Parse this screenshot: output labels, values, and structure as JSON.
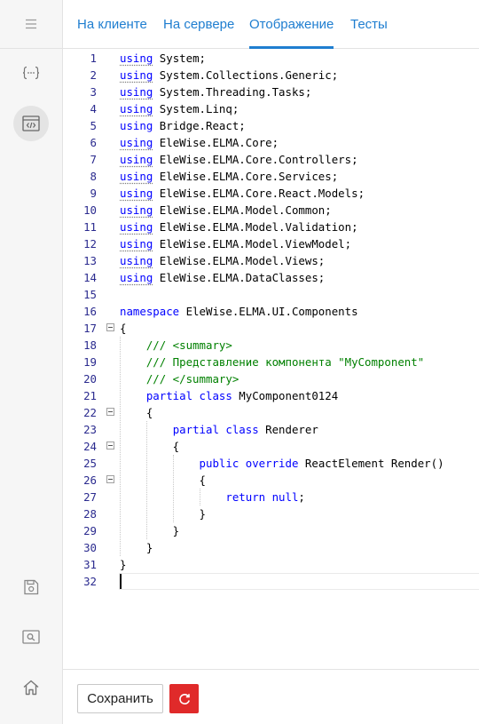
{
  "sidebar": {
    "menu_icon": "hamburger-menu-icon",
    "items": [
      {
        "icon": "code-braces-icon"
      },
      {
        "icon": "code-window-icon",
        "active": true
      },
      {
        "icon": "save-icon"
      },
      {
        "icon": "search-window-icon"
      },
      {
        "icon": "home-icon"
      }
    ]
  },
  "tabs": [
    {
      "label": "На клиенте"
    },
    {
      "label": "На сервере"
    },
    {
      "label": "Отображение",
      "active": true
    },
    {
      "label": "Тесты"
    }
  ],
  "editor": {
    "lines": [
      {
        "n": "1",
        "parts": [
          [
            "uw",
            "using"
          ],
          [
            "t",
            " System;"
          ]
        ]
      },
      {
        "n": "2",
        "parts": [
          [
            "uw",
            "using"
          ],
          [
            "t",
            " System.Collections.Generic;"
          ]
        ]
      },
      {
        "n": "3",
        "parts": [
          [
            "uw",
            "using"
          ],
          [
            "t",
            " System.Threading.Tasks;"
          ]
        ]
      },
      {
        "n": "4",
        "parts": [
          [
            "uw",
            "using"
          ],
          [
            "t",
            " System.Linq;"
          ]
        ]
      },
      {
        "n": "5",
        "parts": [
          [
            "kw",
            "using"
          ],
          [
            "t",
            " Bridge.React;"
          ]
        ]
      },
      {
        "n": "6",
        "parts": [
          [
            "uw",
            "using"
          ],
          [
            "t",
            " EleWise.ELMA.Core;"
          ]
        ]
      },
      {
        "n": "7",
        "parts": [
          [
            "uw",
            "using"
          ],
          [
            "t",
            " EleWise.ELMA.Core.Controllers;"
          ]
        ]
      },
      {
        "n": "8",
        "parts": [
          [
            "uw",
            "using"
          ],
          [
            "t",
            " EleWise.ELMA.Core.Services;"
          ]
        ]
      },
      {
        "n": "9",
        "parts": [
          [
            "uw",
            "using"
          ],
          [
            "t",
            " EleWise.ELMA.Core.React.Models;"
          ]
        ]
      },
      {
        "n": "10",
        "parts": [
          [
            "uw",
            "using"
          ],
          [
            "t",
            " EleWise.ELMA.Model.Common;"
          ]
        ]
      },
      {
        "n": "11",
        "parts": [
          [
            "uw",
            "using"
          ],
          [
            "t",
            " EleWise.ELMA.Model.Validation;"
          ]
        ]
      },
      {
        "n": "12",
        "parts": [
          [
            "uw",
            "using"
          ],
          [
            "t",
            " EleWise.ELMA.Model.ViewModel;"
          ]
        ]
      },
      {
        "n": "13",
        "parts": [
          [
            "uw",
            "using"
          ],
          [
            "t",
            " EleWise.ELMA.Model.Views;"
          ]
        ]
      },
      {
        "n": "14",
        "parts": [
          [
            "uw",
            "using"
          ],
          [
            "t",
            " EleWise.ELMA.DataClasses;"
          ]
        ]
      },
      {
        "n": "15",
        "parts": []
      },
      {
        "n": "16",
        "parts": [
          [
            "kw",
            "namespace"
          ],
          [
            "t",
            " EleWise.ELMA.UI.Components"
          ]
        ]
      },
      {
        "n": "17",
        "fold": true,
        "parts": [
          [
            "t",
            "{"
          ]
        ]
      },
      {
        "n": "18",
        "parts": [
          [
            "t",
            "    "
          ],
          [
            "cm",
            "/// <summary>"
          ]
        ]
      },
      {
        "n": "19",
        "parts": [
          [
            "t",
            "    "
          ],
          [
            "cm",
            "/// Представление компонента \"MyComponent\""
          ]
        ]
      },
      {
        "n": "20",
        "parts": [
          [
            "t",
            "    "
          ],
          [
            "cm",
            "/// </summary>"
          ]
        ]
      },
      {
        "n": "21",
        "parts": [
          [
            "t",
            "    "
          ],
          [
            "kw",
            "partial class"
          ],
          [
            "t",
            " MyComponent0124"
          ]
        ]
      },
      {
        "n": "22",
        "fold": true,
        "parts": [
          [
            "t",
            "    {"
          ]
        ]
      },
      {
        "n": "23",
        "parts": [
          [
            "t",
            "        "
          ],
          [
            "kw",
            "partial class"
          ],
          [
            "t",
            " Renderer"
          ]
        ]
      },
      {
        "n": "24",
        "fold": true,
        "parts": [
          [
            "t",
            "        {"
          ]
        ]
      },
      {
        "n": "25",
        "parts": [
          [
            "t",
            "            "
          ],
          [
            "kw",
            "public override"
          ],
          [
            "t",
            " ReactElement Render()"
          ]
        ]
      },
      {
        "n": "26",
        "fold": true,
        "parts": [
          [
            "t",
            "            {"
          ]
        ]
      },
      {
        "n": "27",
        "parts": [
          [
            "t",
            "                "
          ],
          [
            "kw",
            "return null"
          ],
          [
            "t",
            ";"
          ]
        ]
      },
      {
        "n": "28",
        "parts": [
          [
            "t",
            "            }"
          ]
        ]
      },
      {
        "n": "29",
        "parts": [
          [
            "t",
            "        }"
          ]
        ]
      },
      {
        "n": "30",
        "parts": [
          [
            "t",
            "    }"
          ]
        ]
      },
      {
        "n": "31",
        "parts": [
          [
            "t",
            "}"
          ]
        ]
      },
      {
        "n": "32",
        "parts": [],
        "current": true
      }
    ]
  },
  "footer": {
    "save_label": "Сохранить",
    "reset_icon": "refresh-icon",
    "reset_color": "#e02a2a"
  },
  "colors": {
    "accent": "#1f7ed0",
    "keyword": "#0000ff",
    "comment": "#008000",
    "line_number": "#2b2b8f"
  }
}
